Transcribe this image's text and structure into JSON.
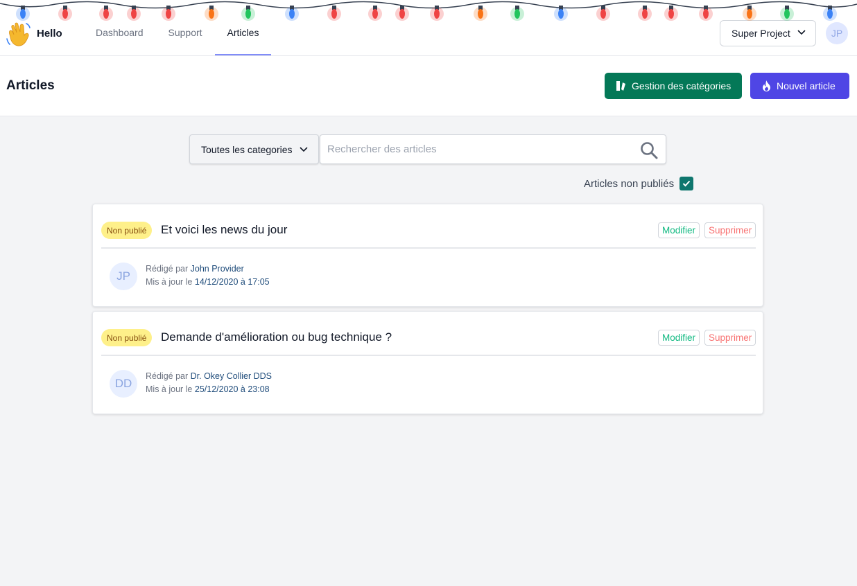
{
  "nav": {
    "brand": "Hello",
    "links": [
      "Dashboard",
      "Support",
      "Articles"
    ],
    "project": "Super Project",
    "user_initials": "JP"
  },
  "header": {
    "title": "Articles",
    "categories_button": "Gestion des catégories",
    "new_article_button": "Nouvel article"
  },
  "filters": {
    "category": "Toutes les categories",
    "search_placeholder": "Rechercher des articles",
    "unpublished_label": "Articles non publiés",
    "unpublished_checked": true
  },
  "articles": [
    {
      "status": "Non publié",
      "title": "Et voici les news du jour",
      "edit": "Modifier",
      "delete": "Supprimer",
      "initials": "JP",
      "written_by_label": "Rédigé par",
      "author": "John Provider",
      "updated_label": "Mis à jour le",
      "updated": "14/12/2020 à 17:05"
    },
    {
      "status": "Non publié",
      "title": "Demande d'amélioration ou bug technique ?",
      "edit": "Modifier",
      "delete": "Supprimer",
      "initials": "DD",
      "written_by_label": "Rédigé par",
      "author": "Dr. Okey Collier DDS",
      "updated_label": "Mis à jour le",
      "updated": "25/12/2020 à 23:08"
    }
  ],
  "colors": {
    "green_button": "#047857",
    "indigo_button": "#4f46e5",
    "badge_bg": "#fef08a",
    "checkbox": "#0f766e"
  }
}
